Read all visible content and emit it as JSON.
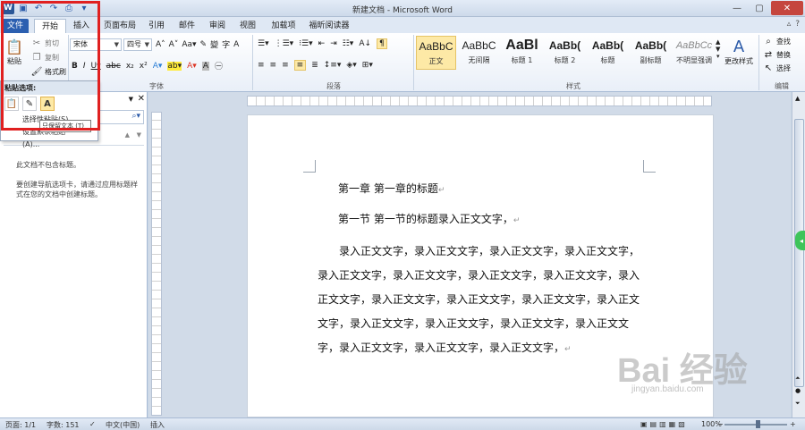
{
  "window": {
    "title": "新建文档 - Microsoft Word"
  },
  "tabs": [
    {
      "label": "文件"
    },
    {
      "label": "开始"
    },
    {
      "label": "插入"
    },
    {
      "label": "页面布局"
    },
    {
      "label": "引用"
    },
    {
      "label": "邮件"
    },
    {
      "label": "审阅"
    },
    {
      "label": "视图"
    },
    {
      "label": "加载项"
    },
    {
      "label": "福昕阅读器"
    }
  ],
  "ribbon": {
    "clipboard": {
      "paste_label": "粘贴",
      "cut_label": "剪切",
      "copy_label": "复制",
      "format_painter_label": "格式刷"
    },
    "font": {
      "group_label": "字体",
      "font_name": "宋体",
      "font_size": "四号"
    },
    "paragraph": {
      "group_label": "段落"
    },
    "styles": {
      "group_label": "样式",
      "items": [
        {
          "sample": "AaBbC",
          "label": "正文"
        },
        {
          "sample": "AaBbC",
          "label": "无间隔"
        },
        {
          "sample": "AaBl",
          "label": "标题 1"
        },
        {
          "sample": "AaBb(",
          "label": "标题 2"
        },
        {
          "sample": "AaBb(",
          "label": "标题"
        },
        {
          "sample": "AaBb(",
          "label": "副标题"
        },
        {
          "sample": "AaBbCc",
          "label": "不明显强调"
        }
      ],
      "change_styles_label": "更改样式"
    },
    "editing": {
      "group_label": "编辑",
      "find_label": "查找",
      "replace_label": "替换",
      "select_label": "选择"
    }
  },
  "paste_menu": {
    "header": "粘贴选项:",
    "item1": "选择性粘贴(S)...",
    "item2": "设置默认粘贴(A)...",
    "tooltip": "只保留文本 (T)"
  },
  "nav_pane": {
    "msg1": "此文档不包含标题。",
    "msg2": "要创建导航选项卡，请通过应用标题样式在您的文档中创建标题。"
  },
  "document": {
    "line1": "第一章 第一章的标题",
    "line2": "第一节 第一节的标题录入正文文字，",
    "paragraph": "录入正文文字，录入正文文字，录入正文文字，录入正文文字，录入正文文字，录入正文文字，录入正文文字，录入正文文字，录入正文文字，录入正文文字，录入正文文字，录入正文文字，录入正文文字，录入正文文字，录入正文文字，录入正文文字，录入正文文字，录入正文文字，录入正文文字，录入正文文字，"
  },
  "status": {
    "page": "页面: 1/1",
    "words": "字数: 151",
    "lang": "中文(中国)",
    "mode": "插入",
    "zoom": "100%"
  },
  "watermark": {
    "main": "Bai 经验",
    "sub": "jingyan.baidu.com"
  }
}
